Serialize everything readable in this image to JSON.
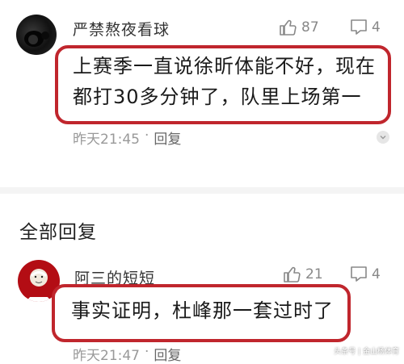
{
  "top_comment": {
    "username": "严禁熬夜看球",
    "likes": "87",
    "replies": "4",
    "text_line1": "上赛季一直说徐昕体能不好，现在",
    "text_line2": "都打30多分钟了，队里上场第一",
    "time": "昨天21:45",
    "separator": "·",
    "reply_label": "回复"
  },
  "section": {
    "title": "全部回复"
  },
  "reply_comment": {
    "username": "阿三的短短",
    "likes": "21",
    "replies": "4",
    "text": "事实证明，杜峰那一套过时了",
    "time": "昨天21:47",
    "separator": "·",
    "reply_label": "回复"
  },
  "watermark": {
    "text": "头条号 | 金山杨体育"
  },
  "colors": {
    "highlight_border": "#c0262d",
    "meta_text": "#999999"
  },
  "icons": {
    "like": "thumbs-up-icon",
    "reply": "comment-icon",
    "more": "chevron-down-icon"
  }
}
